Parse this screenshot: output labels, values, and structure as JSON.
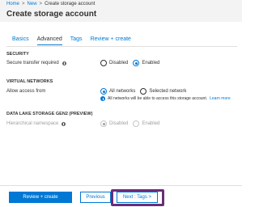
{
  "breadcrumb": {
    "items": [
      "Home",
      "New",
      "Create storage account"
    ],
    "separator": ">"
  },
  "page_title": "Create storage account",
  "tabs": [
    {
      "label": "Basics",
      "active": false
    },
    {
      "label": "Advanced",
      "active": true
    },
    {
      "label": "Tags",
      "active": false
    },
    {
      "label": "Review + create",
      "active": false
    }
  ],
  "security": {
    "title": "SECURITY",
    "secure_transfer_label": "Secure transfer required",
    "options": [
      "Disabled",
      "Enabled"
    ],
    "selected": "Enabled"
  },
  "virtual_networks": {
    "title": "VIRTUAL NETWORKS",
    "allow_access_label": "Allow access from",
    "options": [
      "All networks",
      "Selected network"
    ],
    "selected": "All networks",
    "note": "All networks will be able to access this storage account.",
    "note_link": "Learn more"
  },
  "data_lake": {
    "title": "DATA LAKE STORAGE GEN2 (PREVIEW)",
    "hierarchical_label": "Hierarchical namespace",
    "options": [
      "Disabled",
      "Enabled"
    ],
    "selected": "Disabled"
  },
  "footer": {
    "review_create": "Review + create",
    "previous": "Previous",
    "next": "Next : Tags >"
  },
  "colors": {
    "accent": "#0078d4",
    "highlight": "#6b2c79"
  }
}
